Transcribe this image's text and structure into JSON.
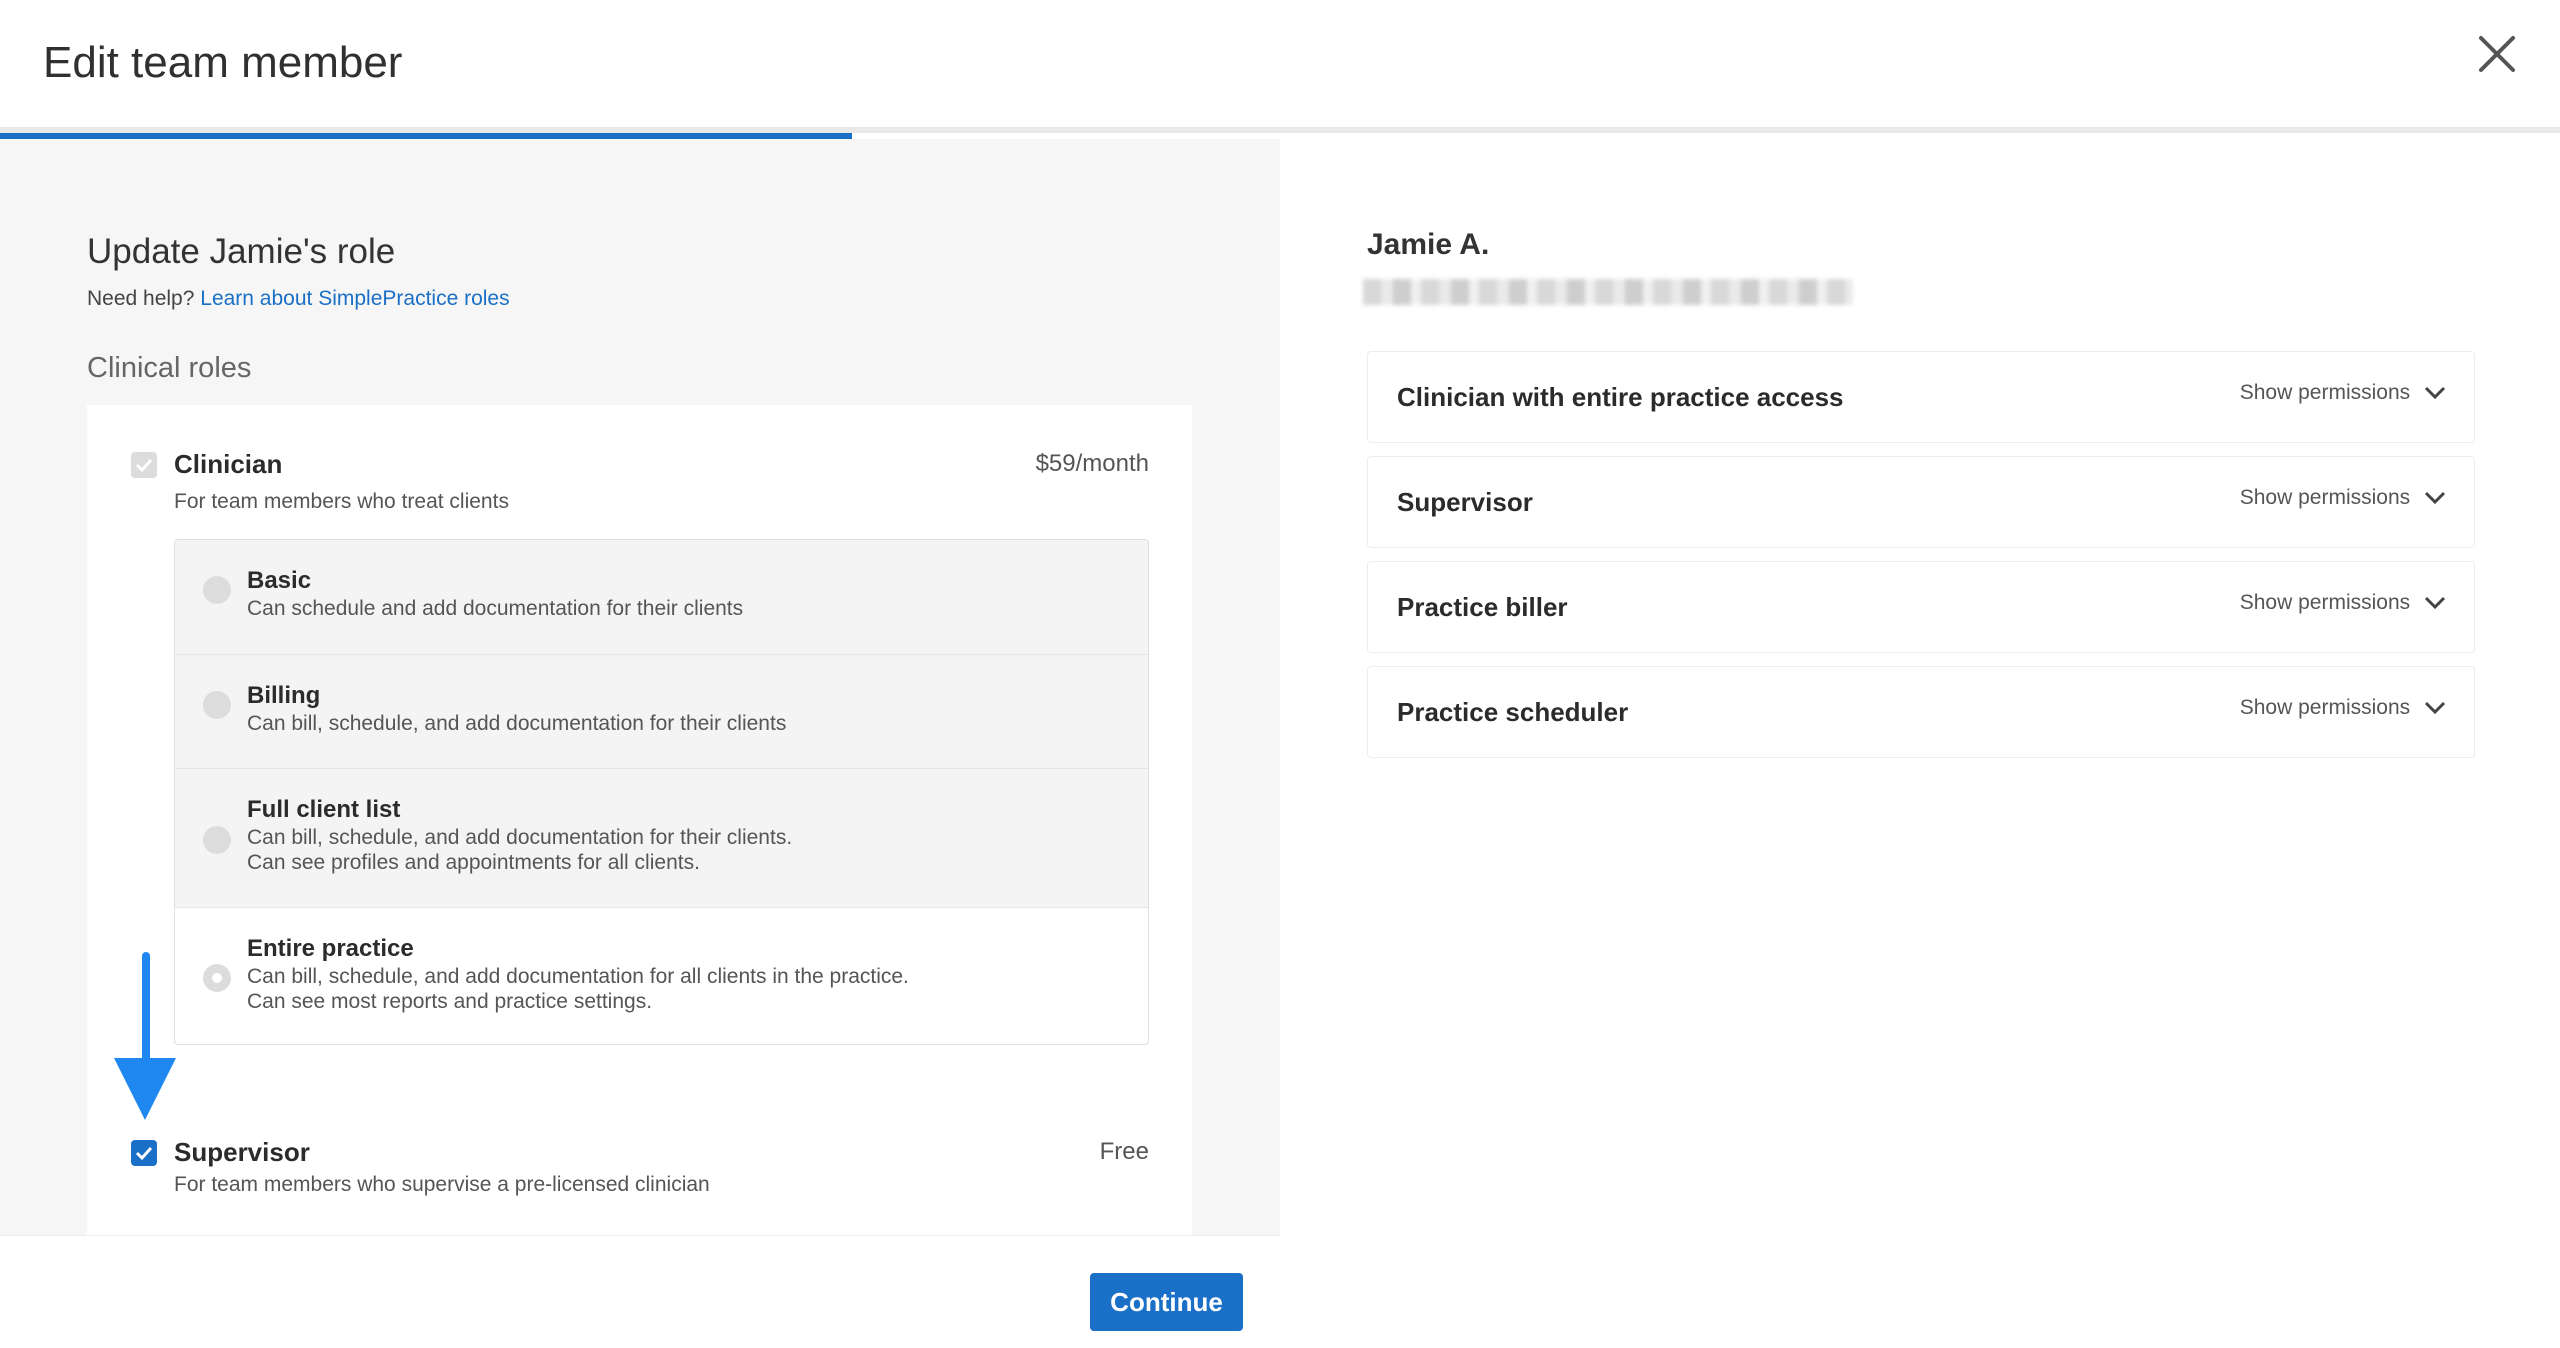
{
  "header": {
    "title": "Edit team member",
    "progress_fraction": 0.333
  },
  "left": {
    "title": "Update Jamie's role",
    "help_prefix": "Need help?",
    "help_link": "Learn about SimplePractice roles",
    "section_heading": "Clinical roles",
    "clinician": {
      "name": "Clinician",
      "description": "For team members who treat clients",
      "price": "$59/month",
      "checked": true,
      "disabled": true,
      "options": [
        {
          "name": "Basic",
          "lines": [
            "Can schedule and add documentation for their clients"
          ],
          "state": "disabled"
        },
        {
          "name": "Billing",
          "lines": [
            "Can bill, schedule, and add documentation for their clients"
          ],
          "state": "disabled"
        },
        {
          "name": "Full client list",
          "lines": [
            "Can bill, schedule, and add documentation for their clients.",
            "Can see profiles and appointments for all clients."
          ],
          "state": "disabled"
        },
        {
          "name": "Entire practice",
          "lines": [
            "Can bill, schedule, and add documentation for all clients in the practice.",
            "Can see most reports and practice settings."
          ],
          "state": "selected"
        }
      ]
    },
    "supervisor": {
      "name": "Supervisor",
      "description": "For team members who supervise a pre-licensed clinician",
      "price": "Free",
      "checked": true
    }
  },
  "footer": {
    "continue_label": "Continue"
  },
  "right": {
    "member_name": "Jamie A.",
    "permissions": [
      {
        "name": "Clinician with entire practice access",
        "toggle": "Show permissions"
      },
      {
        "name": "Supervisor",
        "toggle": "Show permissions"
      },
      {
        "name": "Practice biller",
        "toggle": "Show permissions"
      },
      {
        "name": "Practice scheduler",
        "toggle": "Show permissions"
      }
    ]
  },
  "colors": {
    "accent": "#1a6fc6",
    "annotation_arrow": "#1e88f0"
  }
}
